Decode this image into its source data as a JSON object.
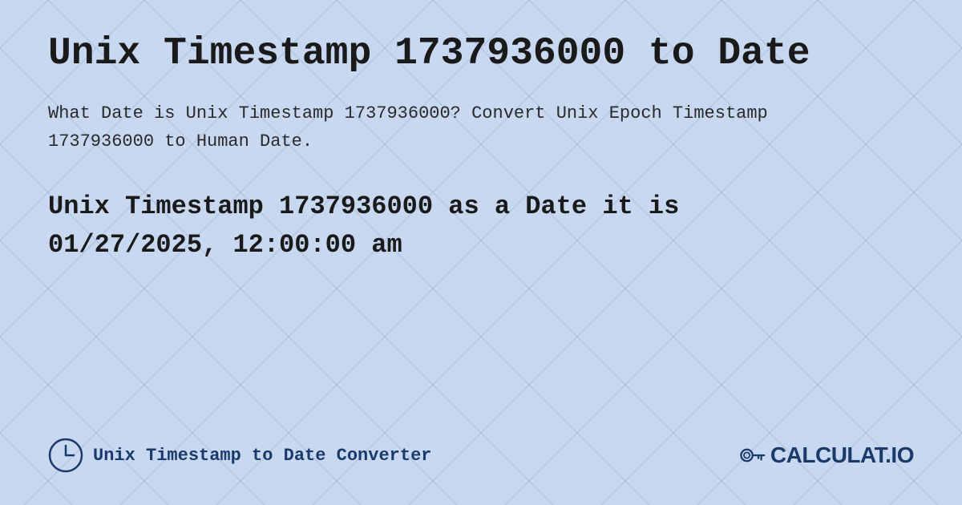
{
  "page": {
    "title": "Unix Timestamp 1737936000 to Date",
    "description": "What Date is Unix Timestamp 1737936000? Convert Unix Epoch Timestamp 1737936000 to Human Date.",
    "result_line1": "Unix Timestamp 1737936000 as a Date it is",
    "result_line2": "01/27/2025, 12:00:00 am",
    "background_color": "#c8d8f0",
    "footer": {
      "label": "Unix Timestamp to Date Converter",
      "logo_text": "CALCULAT.IO"
    }
  }
}
